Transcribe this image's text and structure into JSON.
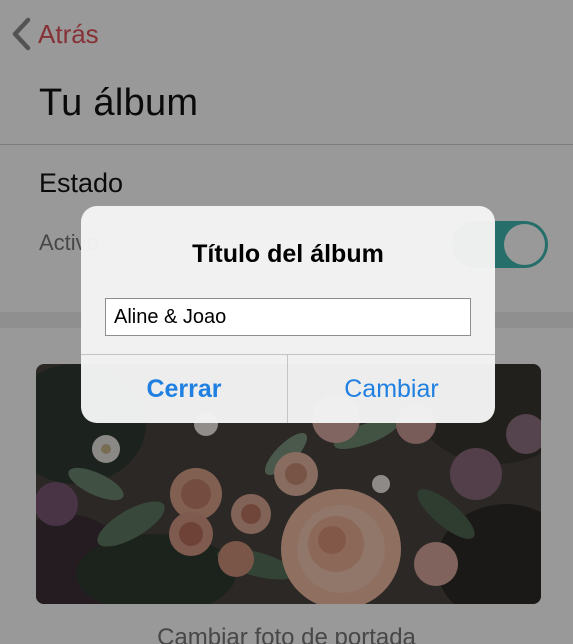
{
  "nav": {
    "back_label": "Atrás"
  },
  "page": {
    "title": "Tu álbum"
  },
  "status_section": {
    "label": "Estado",
    "active_label": "Activo",
    "toggle_on": true
  },
  "cover": {
    "change_label": "Cambiar foto de portada"
  },
  "dialog": {
    "title": "Título del álbum",
    "input_value": "Aline & Joao",
    "close_label": "Cerrar",
    "change_label": "Cambiar"
  },
  "colors": {
    "accent_red": "#e0535a",
    "toggle_teal": "#3eb7b1",
    "dialog_button_blue": "#2080e2"
  },
  "icons": {
    "back": "chevron-left-icon"
  }
}
